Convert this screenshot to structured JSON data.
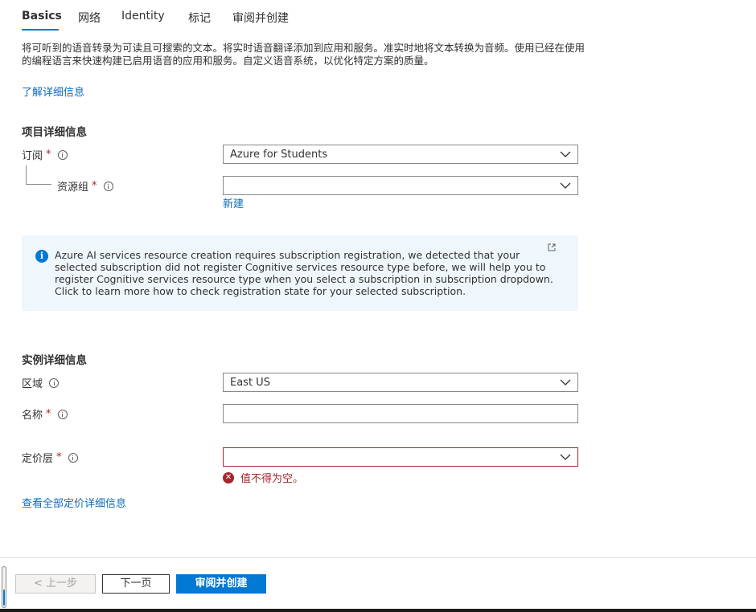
{
  "tabs": [
    {
      "label": "Basics",
      "active": true
    },
    {
      "label": "网络",
      "active": false
    },
    {
      "label": "Identity",
      "active": false
    },
    {
      "label": "标记",
      "active": false
    },
    {
      "label": "审阅并创建",
      "active": false
    }
  ],
  "description": "将可听到的语音转录为可读且可搜索的文本。将实时语音翻译添加到应用和服务。准实时地将文本转换为音频。使用已经在使用的编程语言来快速构建已启用语音的应用和服务。自定义语音系统，以优化特定方案的质量。",
  "learn_more_link": "了解详细信息",
  "project_details": {
    "title": "项目详细信息",
    "subscription_label": "订阅",
    "subscription_value": "Azure for Students",
    "resource_group_label": "资源组",
    "resource_group_value": "",
    "create_new_link": "新建"
  },
  "info_box": {
    "message": "Azure AI services resource creation requires subscription registration, we detected that your selected subscription did not register Cognitive services resource type before, we will help you to register Cognitive services resource type when you select a subscription in subscription dropdown. Click to learn more how to check registration state for your selected subscription."
  },
  "instance_details": {
    "title": "实例详细信息",
    "region_label": "区域",
    "region_value": "East US",
    "name_label": "名称",
    "name_value": "",
    "pricing_label": "定价层",
    "pricing_value": "",
    "pricing_error": "值不得为空。",
    "pricing_link": "查看全部定价详细信息"
  },
  "required_mark": "*",
  "footer": {
    "prev_label": "< 上一步",
    "next_label": "下一页",
    "create_label": "审阅并创建"
  },
  "colors": {
    "accent": "#0078d4",
    "link": "#0f6cbd",
    "error": "#a4262c",
    "info_bg": "#eff6fc"
  }
}
